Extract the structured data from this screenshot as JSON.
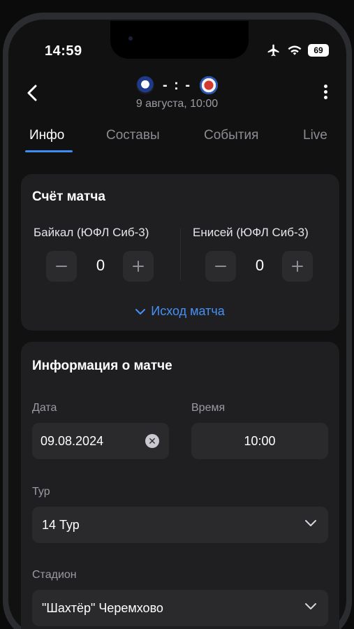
{
  "status_bar": {
    "time": "14:59",
    "battery": "69"
  },
  "header": {
    "score": "- : -",
    "date": "9 августа, 10:00"
  },
  "tabs": [
    {
      "label": "Инфо",
      "active": true
    },
    {
      "label": "Составы",
      "active": false
    },
    {
      "label": "События",
      "active": false
    },
    {
      "label": "Live",
      "active": false
    }
  ],
  "score_card": {
    "title": "Счёт матча",
    "home": {
      "name": "Байкал (ЮФЛ Сиб-3)",
      "score": "0"
    },
    "away": {
      "name": "Енисей (ЮФЛ Сиб-3)",
      "score": "0"
    },
    "outcome_label": "Исход матча"
  },
  "info_card": {
    "title": "Информация о матче",
    "date_label": "Дата",
    "date_value": "09.08.2024",
    "time_label": "Время",
    "time_value": "10:00",
    "round_label": "Тур",
    "round_value": "14 Тур",
    "stadium_label": "Стадион",
    "stadium_value": "\"Шахтёр\" Черемхово"
  },
  "colors": {
    "accent": "#3f8cf4",
    "card": "#1f1f21",
    "field": "#2a2a2d"
  }
}
